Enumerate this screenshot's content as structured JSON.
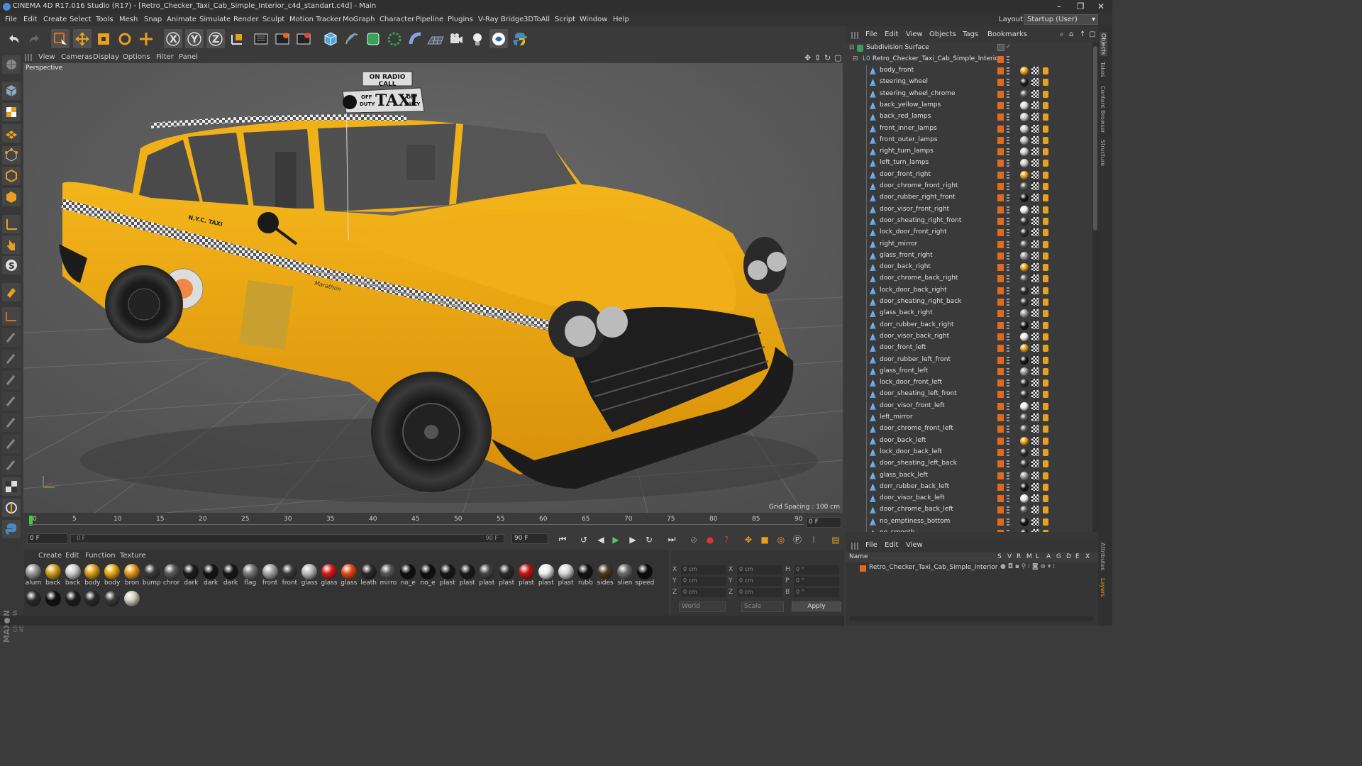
{
  "window": {
    "title": "CINEMA 4D R17.016 Studio (R17) - [Retro_Checker_Taxi_Cab_Simple_Interior_c4d_standart.c4d] - Main",
    "controls": [
      "–",
      "❐",
      "✕"
    ]
  },
  "menubar": {
    "items": [
      "File",
      "Edit",
      "Create",
      "Select",
      "Tools",
      "Mesh",
      "Snap",
      "Animate",
      "Simulate",
      "Render",
      "Sculpt",
      "Motion Tracker",
      "MoGraph",
      "Character",
      "Pipeline",
      "Plugins",
      "V-Ray Bridge",
      "3DToAll",
      "Script",
      "Window",
      "Help"
    ],
    "layout_label": "Layout:",
    "layout_value": "Startup (User)"
  },
  "toolbar": {
    "icons": [
      "undo-icon",
      "redo-icon",
      "live-select-icon",
      "move-icon",
      "scale-icon",
      "rotate-icon",
      "recent-tool-icon",
      "x-axis-icon",
      "y-axis-icon",
      "z-axis-icon",
      "coordinate-system-icon",
      "render-view-icon",
      "render-picture-viewer-icon",
      "edit-render-settings-icon",
      "cube-icon",
      "pen-spline-icon",
      "subdivision-nurbs-icon",
      "array-icon",
      "deformer-icon",
      "floor-scene-icon",
      "camera-icon",
      "light-icon",
      "python-generator-icon",
      "python-icon"
    ]
  },
  "viewport": {
    "menu": [
      "View",
      "Cameras",
      "Display",
      "Options",
      "Filter",
      "Panel"
    ],
    "label": "Perspective",
    "grid_spacing": "Grid Spacing : 100 cm",
    "sign_top": "ON RADIO CALL",
    "sign_main": "TAXI",
    "sign_off": "OFF",
    "sign_duty": "DUTY",
    "door_text": "N.Y.C. TAXI",
    "badge": "Marathon"
  },
  "timeline": {
    "ticks": [
      "0",
      "5",
      "10",
      "15",
      "20",
      "25",
      "30",
      "35",
      "40",
      "45",
      "50",
      "55",
      "60",
      "65",
      "70",
      "75",
      "80",
      "85",
      "90"
    ],
    "current_frame_right": "0 F"
  },
  "transport": {
    "start_field": "0 F",
    "slider_left": "0 F",
    "slider_right": "90 F",
    "end_field": "90 F"
  },
  "material_panel": {
    "menu": [
      "Create",
      "Edit",
      "Function",
      "Texture"
    ],
    "row1": [
      {
        "name": "alum",
        "color": "#9a9a9a"
      },
      {
        "name": "back",
        "color": "#d4a017"
      },
      {
        "name": "back",
        "color": "#cfcfcf"
      },
      {
        "name": "body",
        "color": "#e0a010"
      },
      {
        "name": "body",
        "color": "#e8a812"
      },
      {
        "name": "bron",
        "color": "#e69a12"
      },
      {
        "name": "bump",
        "color": "#3a3a3a"
      },
      {
        "name": "chror",
        "color": "#5a5a5a"
      },
      {
        "name": "dark",
        "color": "#1b1b1b"
      },
      {
        "name": "dark",
        "color": "#111111"
      },
      {
        "name": "dark",
        "color": "#151515"
      },
      {
        "name": "flag",
        "color": "#777777"
      },
      {
        "name": "front",
        "color": "#a5a5a5"
      },
      {
        "name": "front",
        "color": "#3a3a3a"
      },
      {
        "name": "glass",
        "color": "#bbbbbb"
      },
      {
        "name": "glass",
        "color": "#d81818"
      },
      {
        "name": "glass",
        "color": "#e54b12"
      },
      {
        "name": "leath",
        "color": "#282828"
      },
      {
        "name": "mirro",
        "color": "#555555"
      },
      {
        "name": "no_e",
        "color": "#0d0d0d"
      },
      {
        "name": "no_e",
        "color": "#0d0d0d"
      },
      {
        "name": "plast",
        "color": "#161616"
      },
      {
        "name": "plast",
        "color": "#1a1a1a"
      },
      {
        "name": "plast",
        "color": "#444444"
      },
      {
        "name": "plast",
        "color": "#2a2a2a"
      },
      {
        "name": "plast",
        "color": "#c81414"
      },
      {
        "name": "plast",
        "color": "#eeeeee"
      },
      {
        "name": "plast",
        "color": "#d8d8d8"
      },
      {
        "name": "rubb",
        "color": "#111111"
      },
      {
        "name": "sides",
        "color": "#4a3a22"
      },
      {
        "name": "slien",
        "color": "#6a6a6a"
      },
      {
        "name": "speed",
        "color": "#0a0a0a"
      }
    ],
    "row2": [
      {
        "name": "",
        "color": "#2b2b2b"
      },
      {
        "name": "",
        "color": "#0e0e0e"
      },
      {
        "name": "",
        "color": "#1c1c1c"
      },
      {
        "name": "",
        "color": "#2a2a2a"
      },
      {
        "name": "",
        "color": "#3a3a3a"
      },
      {
        "name": "",
        "color": "#cfcfc0"
      }
    ]
  },
  "coords": {
    "row_x": [
      "X",
      "0 cm",
      "X",
      "0 cm",
      "H",
      "0 °"
    ],
    "row_y": [
      "Y",
      "0 cm",
      "Y",
      "0 cm",
      "P",
      "0 °"
    ],
    "row_z": [
      "Z",
      "0 cm",
      "Z",
      "0 cm",
      "B",
      "0 °"
    ],
    "mode1": "World",
    "mode2": "Scale",
    "apply": "Apply"
  },
  "object_manager": {
    "menu": [
      "File",
      "Edit",
      "View",
      "Objects",
      "Tags",
      "Bookmarks"
    ],
    "root": "Subdivision Surface",
    "group": "Retro_Checker_Taxi_Cab_Simple_Interior",
    "objects": [
      {
        "name": "body_front",
        "mat": "#e8a012"
      },
      {
        "name": "steering_wheel",
        "mat": "#1a1a1a"
      },
      {
        "name": "steering_wheel_chrome",
        "mat": "#555"
      },
      {
        "name": "back_yellow_lamps",
        "mat": "#ddd"
      },
      {
        "name": "back_red_lamps",
        "mat": "#ccc"
      },
      {
        "name": "front_inner_lamps",
        "mat": "#ccc"
      },
      {
        "name": "front_outer_lamps",
        "mat": "#bbb"
      },
      {
        "name": "right_turn_lamps",
        "mat": "#ccc"
      },
      {
        "name": "left_turn_lamps",
        "mat": "#ccc"
      },
      {
        "name": "door_front_right",
        "mat": "#e8a012"
      },
      {
        "name": "door_chrome_front_right",
        "mat": "#555"
      },
      {
        "name": "door_rubber_right_front",
        "mat": "#111"
      },
      {
        "name": "door_visor_front_right",
        "mat": "#eee"
      },
      {
        "name": "door_sheating_right_front",
        "mat": "#333"
      },
      {
        "name": "lock_door_front_right",
        "mat": "#2a2a2a"
      },
      {
        "name": "right_mirror",
        "mat": "#555"
      },
      {
        "name": "glass_front_right",
        "mat": "#999"
      },
      {
        "name": "door_back_right",
        "mat": "#e8a012"
      },
      {
        "name": "door_chrome_back_right",
        "mat": "#555"
      },
      {
        "name": "lock_door_back_right",
        "mat": "#2a2a2a"
      },
      {
        "name": "door_sheating_right_back",
        "mat": "#333"
      },
      {
        "name": "glass_back_right",
        "mat": "#999"
      },
      {
        "name": "dorr_rubber_back_right",
        "mat": "#111"
      },
      {
        "name": "door_visor_back_right",
        "mat": "#eee"
      },
      {
        "name": "door_front_left",
        "mat": "#e8a012"
      },
      {
        "name": "door_rubber_left_front",
        "mat": "#111"
      },
      {
        "name": "glass_front_left",
        "mat": "#999"
      },
      {
        "name": "lock_door_front_left",
        "mat": "#2a2a2a"
      },
      {
        "name": "door_sheating_left_front",
        "mat": "#333"
      },
      {
        "name": "door_visor_front_left",
        "mat": "#eee"
      },
      {
        "name": "left_mirror",
        "mat": "#555"
      },
      {
        "name": "door_chrome_front_left",
        "mat": "#555"
      },
      {
        "name": "door_back_left",
        "mat": "#e8a012"
      },
      {
        "name": "lock_door_back_left",
        "mat": "#2a2a2a"
      },
      {
        "name": "door_sheating_left_back",
        "mat": "#333"
      },
      {
        "name": "glass_back_left",
        "mat": "#999"
      },
      {
        "name": "dorr_rubber_back_left",
        "mat": "#111"
      },
      {
        "name": "door_visor_back_left",
        "mat": "#eee"
      },
      {
        "name": "door_chrome_back_left",
        "mat": "#555"
      },
      {
        "name": "no_emptiness_bottom",
        "mat": "#111"
      },
      {
        "name": "no_smooth",
        "mat": "#111"
      }
    ]
  },
  "layer_manager": {
    "menu": [
      "File",
      "Edit",
      "View"
    ],
    "cols": [
      "Name",
      "S",
      "V",
      "R",
      "M",
      "L",
      "A",
      "G",
      "D",
      "E",
      "X"
    ],
    "row": "Retro_Checker_Taxi_Cab_Simple_Interior"
  },
  "right_tabs": [
    "Objects",
    "Takes",
    "Content Browser",
    "Structure"
  ],
  "right_tabs_lower": [
    "Attributes",
    "Layers"
  ],
  "brand": {
    "maxon": "MAXON",
    "c4d": "CINEMA 4D"
  },
  "colors": {
    "accent": "#e06b1e",
    "bg": "#3b3b3b",
    "select": "#4a8fd6"
  }
}
